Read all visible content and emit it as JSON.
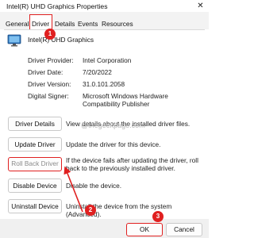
{
  "window": {
    "title": "Intel(R) UHD Graphics Properties",
    "close_glyph": "✕"
  },
  "tabs": [
    {
      "label": "General",
      "active": false
    },
    {
      "label": "Driver",
      "active": true
    },
    {
      "label": "Details",
      "active": false
    },
    {
      "label": "Events",
      "active": false
    },
    {
      "label": "Resources",
      "active": false
    }
  ],
  "device": {
    "name": "Intel(R) UHD Graphics",
    "icon": "monitor-icon"
  },
  "info": [
    {
      "label": "Driver Provider:",
      "value": "Intel Corporation"
    },
    {
      "label": "Driver Date:",
      "value": "7/20/2022"
    },
    {
      "label": "Driver Version:",
      "value": "31.0.101.2058"
    },
    {
      "label": "Digital Signer:",
      "value": "Microsoft Windows Hardware Compatibility Publisher"
    }
  ],
  "actions": [
    {
      "label": "Driver Details",
      "desc": "View details about the installed driver files.",
      "enabled": true
    },
    {
      "label": "Update Driver",
      "desc": "Update the driver for this device.",
      "enabled": true
    },
    {
      "label": "Roll Back Driver",
      "desc": "If the device fails after updating the driver, roll back to the previously installed driver.",
      "enabled": false
    },
    {
      "label": "Disable Device",
      "desc": "Disable the device.",
      "enabled": true
    },
    {
      "label": "Uninstall Device",
      "desc": "Uninstall the device from the system (Advanced).",
      "enabled": true
    }
  ],
  "watermark": "@thegeekpage.com",
  "footer": {
    "ok_label": "OK",
    "cancel_label": "Cancel"
  },
  "badges": [
    "1",
    "2",
    "3"
  ],
  "colors": {
    "highlight": "#e02020"
  }
}
